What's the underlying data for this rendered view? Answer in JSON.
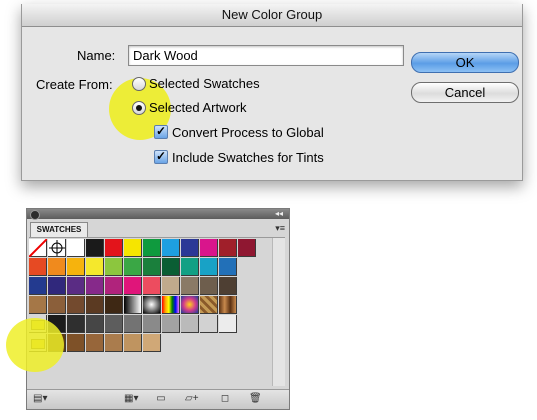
{
  "dialog": {
    "title": "New Color Group",
    "name_label": "Name:",
    "name_value": "Dark Wood",
    "create_from_label": "Create From:",
    "radio_selected_swatches": "Selected Swatches",
    "radio_selected_artwork": "Selected Artwork",
    "selected_option": "Selected Artwork",
    "check_convert": "Convert Process to Global",
    "check_include": "Include Swatches for Tints",
    "ok_label": "OK",
    "cancel_label": "Cancel"
  },
  "panel": {
    "tab_label": "SWATCHES",
    "menu_icon": "panel-menu-icon",
    "rows": [
      [
        "none",
        "registration",
        "#ffffff",
        "#1a1a1a",
        "#e3141b",
        "#f6e500",
        "#0f9a3e",
        "#1e9fe0",
        "#2b3896",
        "#d9158c",
        "#a01f2a",
        "#8f1731"
      ],
      [
        "#e64a23",
        "#f08a1d",
        "#f6b30d",
        "#f5e82c",
        "#8cc63e",
        "#3aa745",
        "#1a7f3c",
        "#0a5e34",
        "#12a084",
        "#18a2c6",
        "#2270b8"
      ],
      [
        "#233a8f",
        "#30287c",
        "#5a2c84",
        "#86298a",
        "#b0237c",
        "#e0157a",
        "#ed4c5f",
        "#c0aa8c",
        "#8a7a66",
        "#6e5e4d",
        "#4e3f33"
      ],
      [
        "#a57747",
        "#8b5f3a",
        "#734a2e",
        "#5b3a22",
        "#3e2814",
        "gradient-gray",
        "gradient-radial",
        "gradient-rainbow",
        "gradient-blue",
        "pattern",
        "gradient-wood"
      ],
      [
        "folder",
        "#1b1b1b",
        "#2f2f2f",
        "#464646",
        "#5d5d5d",
        "#737373",
        "#8a8a8a",
        "#a2a2a2",
        "#bababa",
        "#d2d2d2",
        "#ececec"
      ],
      [
        "folder",
        "#5a3a14",
        "#7e5128",
        "#97663a",
        "#aa7c4d",
        "#bf9460",
        "#d0a877"
      ]
    ],
    "bottom_icons": [
      "swatch-libraries-icon",
      "show-swatch-kinds-icon",
      "swatch-options-icon",
      "new-color-group-icon",
      "new-swatch-icon",
      "delete-swatch-icon"
    ]
  },
  "highlights": [
    "yellow-circle-radio",
    "yellow-circle-folder"
  ]
}
